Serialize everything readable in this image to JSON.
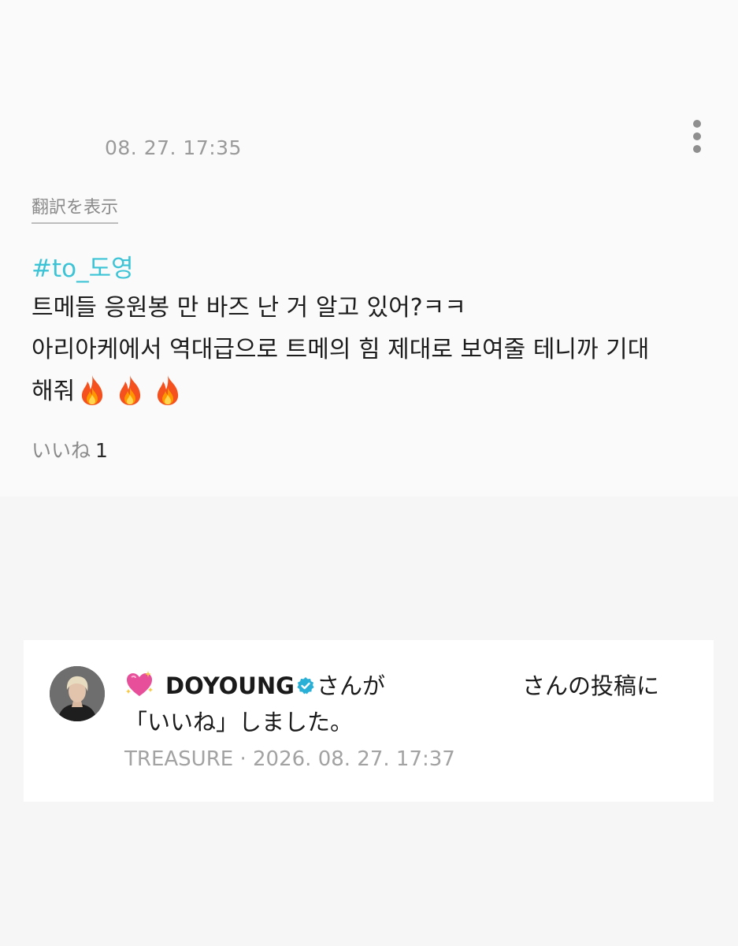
{
  "post": {
    "timestamp": "08. 27. 17:35",
    "translate_label": "翻訳を表示",
    "hashtag": "#to_도영",
    "body_line1": "트메들 응원봉 만 바즈 난 거 알고 있어?ㅋㅋ",
    "body_line2": "아리아케에서 역대급으로 트메의 힘 제대로 보여줄 테니까 기대",
    "body_line3": "해줘",
    "emoji_icons": [
      "fire-icon",
      "fire-icon",
      "fire-icon"
    ],
    "like_label": "いいね",
    "like_count": "1"
  },
  "notification": {
    "icon": "sparkling-heart-icon",
    "username": "DOYOUNG",
    "verified_icon": "verified-badge-icon",
    "text_after_name": "さんが",
    "text_after_redacted": "さんの投稿に",
    "line2": "「いいね」しました。",
    "group": "TREASURE",
    "separator": "·",
    "datetime": "2026. 08. 27. 17:37"
  },
  "colors": {
    "hashtag": "#3cc4d6",
    "muted_text": "#9a9a9a",
    "verified": "#2ab0d6"
  }
}
